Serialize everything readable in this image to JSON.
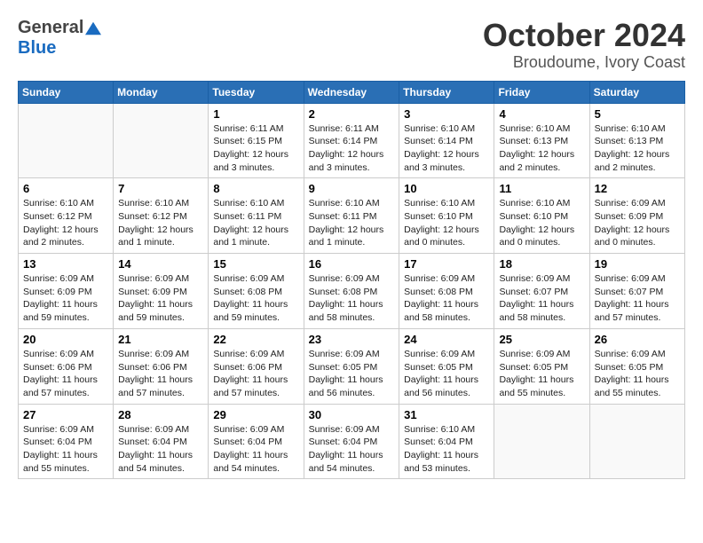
{
  "header": {
    "logo_general": "General",
    "logo_blue": "Blue",
    "month": "October 2024",
    "location": "Broudoume, Ivory Coast"
  },
  "weekdays": [
    "Sunday",
    "Monday",
    "Tuesday",
    "Wednesday",
    "Thursday",
    "Friday",
    "Saturday"
  ],
  "weeks": [
    [
      {
        "day": "",
        "text": ""
      },
      {
        "day": "",
        "text": ""
      },
      {
        "day": "1",
        "text": "Sunrise: 6:11 AM\nSunset: 6:15 PM\nDaylight: 12 hours\nand 3 minutes."
      },
      {
        "day": "2",
        "text": "Sunrise: 6:11 AM\nSunset: 6:14 PM\nDaylight: 12 hours\nand 3 minutes."
      },
      {
        "day": "3",
        "text": "Sunrise: 6:10 AM\nSunset: 6:14 PM\nDaylight: 12 hours\nand 3 minutes."
      },
      {
        "day": "4",
        "text": "Sunrise: 6:10 AM\nSunset: 6:13 PM\nDaylight: 12 hours\nand 2 minutes."
      },
      {
        "day": "5",
        "text": "Sunrise: 6:10 AM\nSunset: 6:13 PM\nDaylight: 12 hours\nand 2 minutes."
      }
    ],
    [
      {
        "day": "6",
        "text": "Sunrise: 6:10 AM\nSunset: 6:12 PM\nDaylight: 12 hours\nand 2 minutes."
      },
      {
        "day": "7",
        "text": "Sunrise: 6:10 AM\nSunset: 6:12 PM\nDaylight: 12 hours\nand 1 minute."
      },
      {
        "day": "8",
        "text": "Sunrise: 6:10 AM\nSunset: 6:11 PM\nDaylight: 12 hours\nand 1 minute."
      },
      {
        "day": "9",
        "text": "Sunrise: 6:10 AM\nSunset: 6:11 PM\nDaylight: 12 hours\nand 1 minute."
      },
      {
        "day": "10",
        "text": "Sunrise: 6:10 AM\nSunset: 6:10 PM\nDaylight: 12 hours\nand 0 minutes."
      },
      {
        "day": "11",
        "text": "Sunrise: 6:10 AM\nSunset: 6:10 PM\nDaylight: 12 hours\nand 0 minutes."
      },
      {
        "day": "12",
        "text": "Sunrise: 6:09 AM\nSunset: 6:09 PM\nDaylight: 12 hours\nand 0 minutes."
      }
    ],
    [
      {
        "day": "13",
        "text": "Sunrise: 6:09 AM\nSunset: 6:09 PM\nDaylight: 11 hours\nand 59 minutes."
      },
      {
        "day": "14",
        "text": "Sunrise: 6:09 AM\nSunset: 6:09 PM\nDaylight: 11 hours\nand 59 minutes."
      },
      {
        "day": "15",
        "text": "Sunrise: 6:09 AM\nSunset: 6:08 PM\nDaylight: 11 hours\nand 59 minutes."
      },
      {
        "day": "16",
        "text": "Sunrise: 6:09 AM\nSunset: 6:08 PM\nDaylight: 11 hours\nand 58 minutes."
      },
      {
        "day": "17",
        "text": "Sunrise: 6:09 AM\nSunset: 6:08 PM\nDaylight: 11 hours\nand 58 minutes."
      },
      {
        "day": "18",
        "text": "Sunrise: 6:09 AM\nSunset: 6:07 PM\nDaylight: 11 hours\nand 58 minutes."
      },
      {
        "day": "19",
        "text": "Sunrise: 6:09 AM\nSunset: 6:07 PM\nDaylight: 11 hours\nand 57 minutes."
      }
    ],
    [
      {
        "day": "20",
        "text": "Sunrise: 6:09 AM\nSunset: 6:06 PM\nDaylight: 11 hours\nand 57 minutes."
      },
      {
        "day": "21",
        "text": "Sunrise: 6:09 AM\nSunset: 6:06 PM\nDaylight: 11 hours\nand 57 minutes."
      },
      {
        "day": "22",
        "text": "Sunrise: 6:09 AM\nSunset: 6:06 PM\nDaylight: 11 hours\nand 57 minutes."
      },
      {
        "day": "23",
        "text": "Sunrise: 6:09 AM\nSunset: 6:05 PM\nDaylight: 11 hours\nand 56 minutes."
      },
      {
        "day": "24",
        "text": "Sunrise: 6:09 AM\nSunset: 6:05 PM\nDaylight: 11 hours\nand 56 minutes."
      },
      {
        "day": "25",
        "text": "Sunrise: 6:09 AM\nSunset: 6:05 PM\nDaylight: 11 hours\nand 55 minutes."
      },
      {
        "day": "26",
        "text": "Sunrise: 6:09 AM\nSunset: 6:05 PM\nDaylight: 11 hours\nand 55 minutes."
      }
    ],
    [
      {
        "day": "27",
        "text": "Sunrise: 6:09 AM\nSunset: 6:04 PM\nDaylight: 11 hours\nand 55 minutes."
      },
      {
        "day": "28",
        "text": "Sunrise: 6:09 AM\nSunset: 6:04 PM\nDaylight: 11 hours\nand 54 minutes."
      },
      {
        "day": "29",
        "text": "Sunrise: 6:09 AM\nSunset: 6:04 PM\nDaylight: 11 hours\nand 54 minutes."
      },
      {
        "day": "30",
        "text": "Sunrise: 6:09 AM\nSunset: 6:04 PM\nDaylight: 11 hours\nand 54 minutes."
      },
      {
        "day": "31",
        "text": "Sunrise: 6:10 AM\nSunset: 6:04 PM\nDaylight: 11 hours\nand 53 minutes."
      },
      {
        "day": "",
        "text": ""
      },
      {
        "day": "",
        "text": ""
      }
    ]
  ]
}
